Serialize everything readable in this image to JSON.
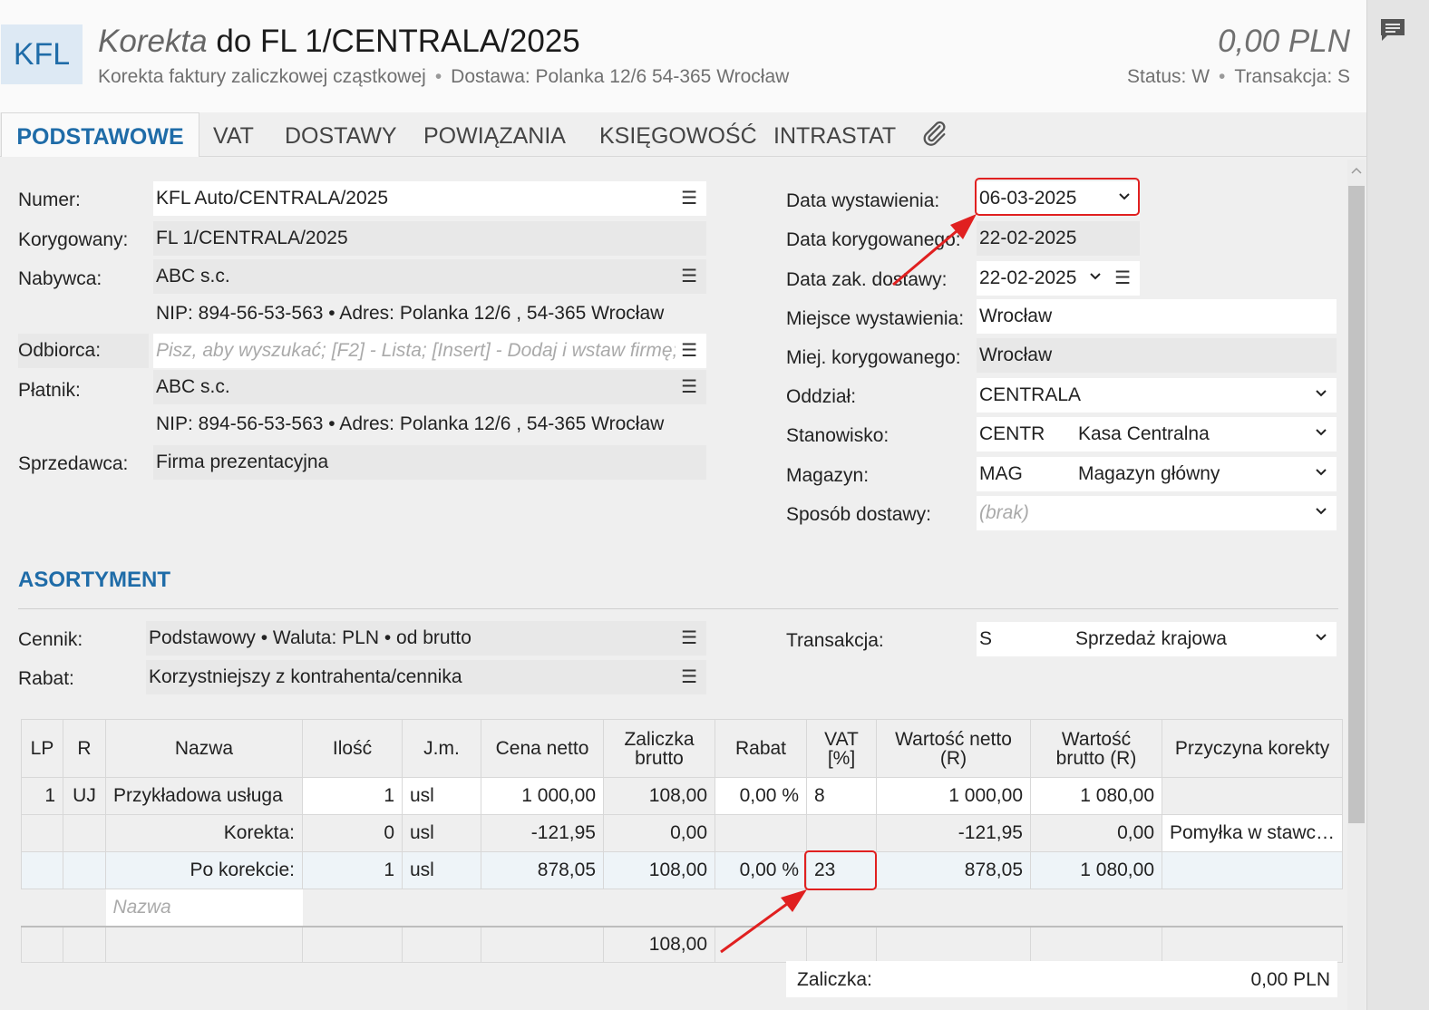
{
  "header": {
    "badge": "KFL",
    "title_prefix": "Korekta",
    "title_rest": "do FL 1/CENTRALA/2025",
    "subtitle_type": "Korekta faktury zaliczkowej cząstkowej",
    "subtitle_delivery": "Dostawa: Polanka  12/6  54-365 Wrocław",
    "amount": "0,00 PLN",
    "status": "Status:  W",
    "transaction": "Transakcja:  S"
  },
  "tabs": [
    "PODSTAWOWE",
    "VAT",
    "DOSTAWY",
    "POWIĄZANIA",
    "KSIĘGOWOŚĆ",
    "INTRASTAT"
  ],
  "left_form": {
    "numer_label": "Numer:",
    "numer_value": "KFL Auto/CENTRALA/2025",
    "korygowany_label": "Korygowany:",
    "korygowany_value": "FL 1/CENTRALA/2025",
    "nabywca_label": "Nabywca:",
    "nabywca_value": "ABC s.c.",
    "nabywca_details": "NIP:  894-56-53-563  •  Adres:  Polanka  12/6 , 54-365 Wrocław",
    "odbiorca_label": "Odbiorca:",
    "odbiorca_placeholder": "Pisz, aby wyszukać; [F2] - Lista; [Insert] - Dodaj i wstaw firmę;",
    "platnik_label": "Płatnik:",
    "platnik_value": "ABC s.c.",
    "platnik_details": "NIP:  894-56-53-563  •  Adres:  Polanka  12/6 , 54-365 Wrocław",
    "sprzedawca_label": "Sprzedawca:",
    "sprzedawca_value": "Firma prezentacyjna"
  },
  "right_form": {
    "data_wyst_label": "Data wystawienia:",
    "data_wyst_value": "06-03-2025",
    "data_kor_label": "Data korygowanego:",
    "data_kor_value": "22-02-2025",
    "data_zak_label": "Data zak. dostawy:",
    "data_zak_value": "22-02-2025",
    "miejsce_label": "Miejsce wystawienia:",
    "miejsce_value": "Wrocław",
    "miej_kor_label": "Miej. korygowanego:",
    "miej_kor_value": "Wrocław",
    "oddzial_label": "Oddział:",
    "oddzial_value": "CENTRALA",
    "stanowisko_label": "Stanowisko:",
    "stanowisko_code": "CENTR",
    "stanowisko_name": "Kasa Centralna",
    "magazyn_label": "Magazyn:",
    "magazyn_code": "MAG",
    "magazyn_name": "Magazyn główny",
    "sposob_label": "Sposób dostawy:",
    "sposob_placeholder": "(brak)"
  },
  "asortyment": {
    "title": "ASORTYMENT",
    "cennik_label": "Cennik:",
    "cennik_value": "Podstawowy • Waluta: PLN • od brutto",
    "rabat_label": "Rabat:",
    "rabat_value": "Korzystniejszy z kontrahenta/cennika",
    "transakcja_label": "Transakcja:",
    "transakcja_code": "S",
    "transakcja_name": "Sprzedaż krajowa"
  },
  "table": {
    "headers": {
      "lp": "LP",
      "r": "R",
      "nazwa": "Nazwa",
      "ilosc": "Ilość",
      "jm": "J.m.",
      "cena": "Cena netto",
      "zal1": "Zaliczka",
      "zal2": "brutto",
      "rabat": "Rabat",
      "vat1": "VAT",
      "vat2": "[%]",
      "wn1": "Wartość netto",
      "wn2": "(R)",
      "wb1": "Wartość",
      "wb2": "brutto (R)",
      "przyczyna": "Przyczyna korekty"
    },
    "row1": {
      "lp": "1",
      "r": "UJ",
      "nazwa": "Przykładowa usługa",
      "ilosc": "1",
      "jm": "usl",
      "cena": "1 000,00",
      "zal": "108,00",
      "rabat": "0,00 %",
      "vat": "8",
      "wn": "1 000,00",
      "wb": "1 080,00",
      "przyczyna": ""
    },
    "row2": {
      "nazwa": "Korekta:",
      "ilosc": "0",
      "jm": "usl",
      "cena": "-121,95",
      "zal": "0,00",
      "rabat": "",
      "vat": "",
      "wn": "-121,95",
      "wb": "0,00",
      "przyczyna": "Pomyłka w stawc…"
    },
    "row3": {
      "nazwa": "Po korekcie:",
      "ilosc": "1",
      "jm": "usl",
      "cena": "878,05",
      "zal": "108,00",
      "rabat": "0,00 %",
      "vat": "23",
      "wn": "878,05",
      "wb": "1 080,00",
      "przyczyna": ""
    },
    "new_row_placeholder": "Nazwa",
    "total_zal": "108,00"
  },
  "footer": {
    "zaliczka_label": "Zaliczka:",
    "zaliczka_value": "0,00 PLN"
  },
  "colors": {
    "accent": "#1f6ca8",
    "highlight": "#e02020"
  }
}
